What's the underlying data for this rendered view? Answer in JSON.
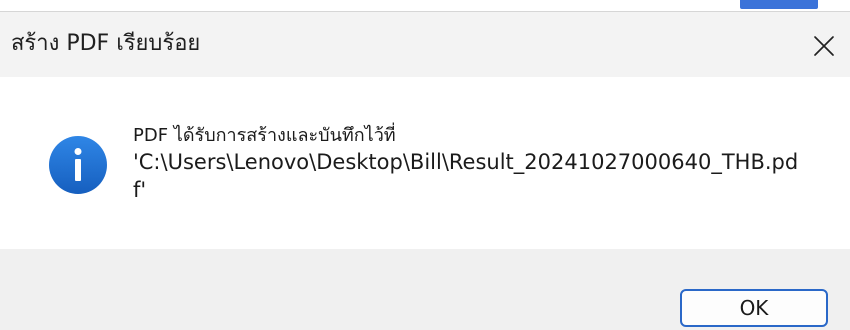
{
  "window": {
    "title": "สร้าง PDF เรียบร้อย",
    "close_icon": "close-icon"
  },
  "message": {
    "icon": "info-icon",
    "line1": "PDF ได้รับการสร้างและบันทึกไว้ที่",
    "path": "'C:\\Users\\Lenovo\\Desktop\\Bill\\Result_20241027000640_THB.pdf'"
  },
  "buttons": {
    "ok_label": "OK"
  },
  "colors": {
    "accent": "#2a68c8",
    "info_icon": "#1e73d1",
    "titlebar": "#f3f3f3",
    "footer": "#f0f0f0"
  }
}
